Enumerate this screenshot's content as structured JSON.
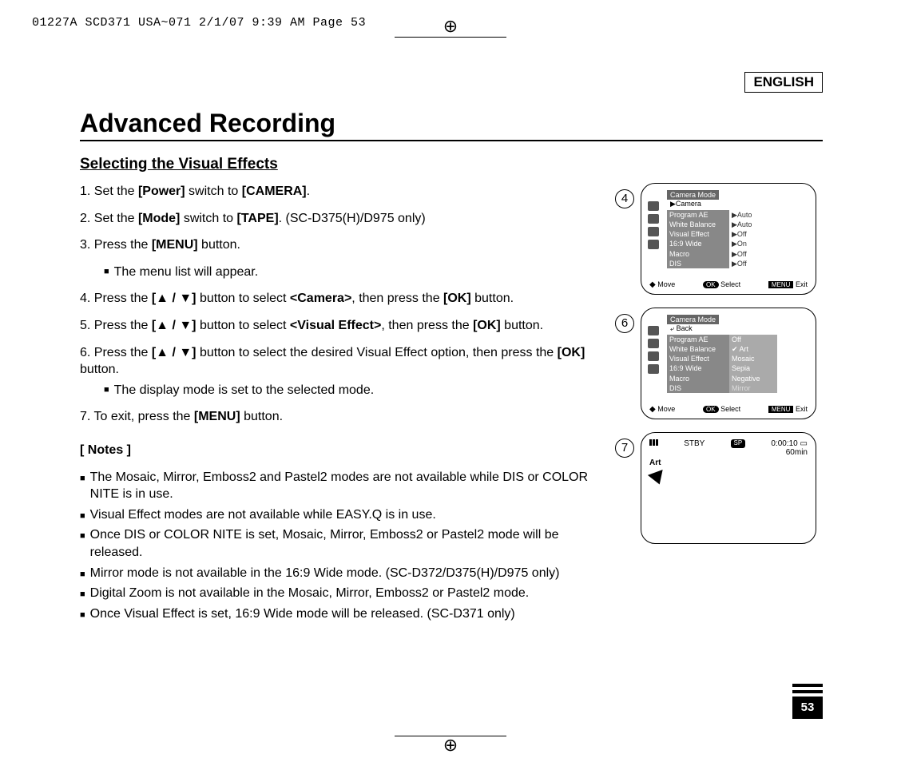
{
  "header_line": "01227A SCD371 USA~071  2/1/07 9:39 AM  Page 53",
  "language_label": "ENGLISH",
  "doc_title": "Advanced Recording",
  "section_title": "Selecting the Visual Effects",
  "steps": {
    "s1a": "1. Set the ",
    "s1b": "[Power]",
    "s1c": " switch to ",
    "s1d": "[CAMERA]",
    "s1e": ".",
    "s2a": "2. Set the ",
    "s2b": "[Mode]",
    "s2c": " switch to ",
    "s2d": "[TAPE]",
    "s2e": ". (SC-D375(H)/D975 only)",
    "s3a": "3. Press the ",
    "s3b": "[MENU]",
    "s3c": " button.",
    "s3sub": "The menu list will appear.",
    "s4a": "4. Press the ",
    "s4b": "[▲ / ▼]",
    "s4c": " button to select ",
    "s4d": "<Camera>",
    "s4e": ", then press the ",
    "s4f": "[OK]",
    "s4g": " button.",
    "s5a": "5. Press the ",
    "s5b": "[▲ / ▼]",
    "s5c": " button to select ",
    "s5d": "<Visual Effect>",
    "s5e": ", then press the ",
    "s5f": "[OK]",
    "s5g": " button.",
    "s6a": "6. Press the ",
    "s6b": "[▲ / ▼]",
    "s6c": " button to select the desired Visual Effect option, then press the ",
    "s6d": "[OK]",
    "s6e": " button.",
    "s6sub": "The display mode is set to the selected mode.",
    "s7a": "7. To exit, press the ",
    "s7b": "[MENU]",
    "s7c": " button."
  },
  "notes_header": "[ Notes ]",
  "notes": [
    "The Mosaic, Mirror, Emboss2 and Pastel2 modes are not available while DIS or COLOR NITE is in use.",
    "Visual Effect modes are not available while EASY.Q is in use.",
    "Once DIS or COLOR NITE is set, Mosaic, Mirror, Emboss2 or Pastel2 mode will be released.",
    "Mirror mode is not available in the 16:9 Wide mode. (SC-D372/D375(H)/D975 only)",
    "Digital Zoom is not available in the Mosaic, Mirror, Emboss2 or Pastel2 mode.",
    "Once Visual Effect is set, 16:9 Wide mode will be released. (SC-D371 only)"
  ],
  "fig4": {
    "num": "4",
    "title": "Camera Mode",
    "breadcrumb": "▶Camera",
    "rows": [
      {
        "label": "Program AE",
        "value": "▶Auto"
      },
      {
        "label": "White Balance",
        "value": "▶Auto"
      },
      {
        "label": "Visual Effect",
        "value": "▶Off"
      },
      {
        "label": "16:9 Wide",
        "value": "▶On"
      },
      {
        "label": "Macro",
        "value": "▶Off"
      },
      {
        "label": "DIS",
        "value": "▶Off"
      }
    ],
    "move": "Move",
    "ok": "OK",
    "select": "Select",
    "menu": "MENU",
    "exit": "Exit"
  },
  "fig6": {
    "num": "6",
    "title": "Camera Mode",
    "breadcrumb": "Back",
    "rows": [
      {
        "label": "Program AE",
        "value": "Off"
      },
      {
        "label": "White Balance",
        "value": "Art",
        "selected": true
      },
      {
        "label": "Visual Effect",
        "value": "Mosaic"
      },
      {
        "label": "16:9 Wide",
        "value": "Sepia"
      },
      {
        "label": "Macro",
        "value": "Negative"
      },
      {
        "label": "DIS",
        "value": "Mirror"
      }
    ],
    "move": "Move",
    "ok": "OK",
    "select": "Select",
    "menu": "MENU",
    "exit": "Exit"
  },
  "fig7": {
    "num": "7",
    "status": "STBY",
    "sp": "SP",
    "timecode": "0:00:10",
    "remain": "60min",
    "effect": "Art"
  },
  "page_number": "53"
}
